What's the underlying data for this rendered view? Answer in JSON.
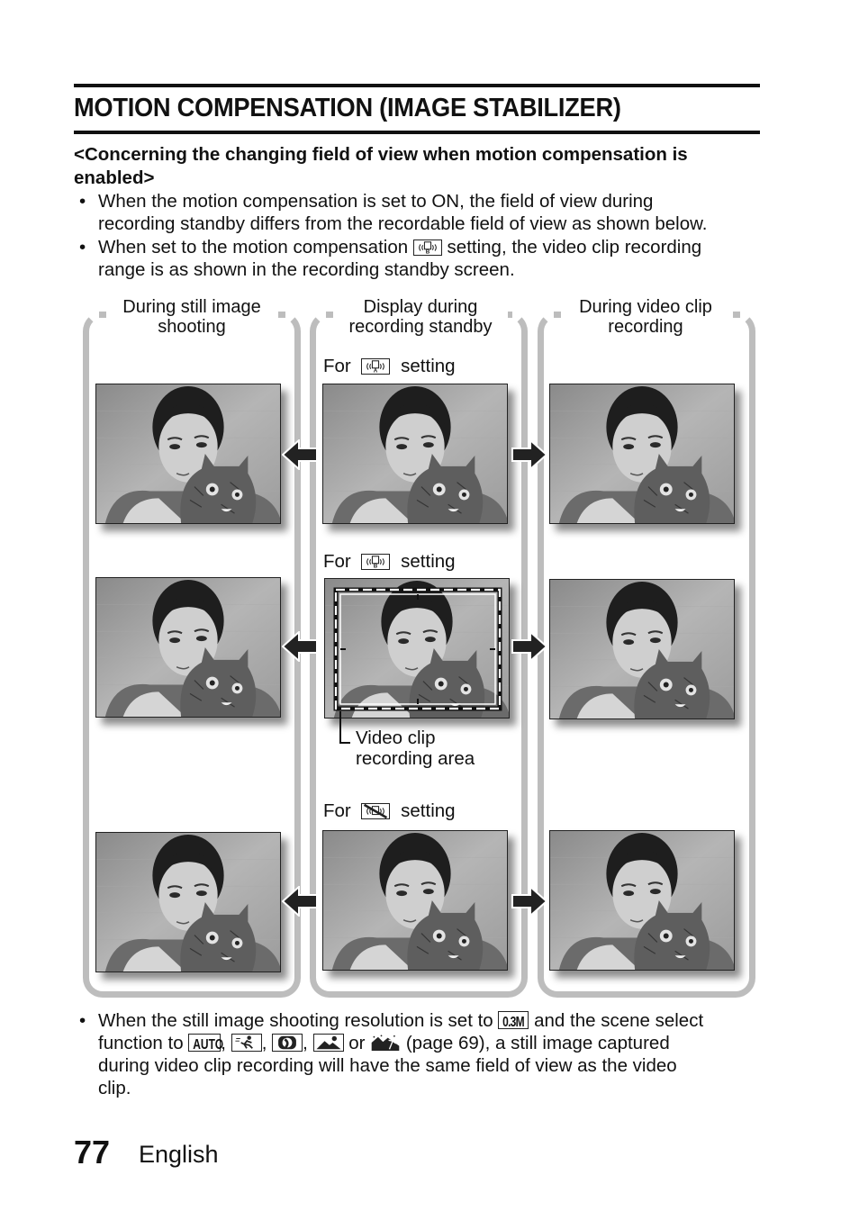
{
  "page": {
    "title": "MOTION COMPENSATION (IMAGE STABILIZER)",
    "subheading": "<Concerning the changing field of view when motion compensation is enabled>",
    "subheading_lines": [
      "<Concerning the changing field of view when motion compensation is",
      "enabled>"
    ],
    "bullets": [
      {
        "lines": [
          "When the motion compensation is set to ON, the field of view during",
          "recording standby differs from the recordable field of view as shown below."
        ]
      },
      {
        "line1_before_icon": "When set to the motion compensation",
        "line1_icon": "stabilizer-b-icon",
        "line1_after_icon": "setting, the video clip recording",
        "line2": "range is as shown in the recording standby screen."
      }
    ],
    "bullet_glyph": "•"
  },
  "diagram": {
    "columns": [
      {
        "label_lines": [
          "During still image",
          "shooting"
        ]
      },
      {
        "label_lines": [
          "Display during",
          "recording standby"
        ]
      },
      {
        "label_lines": [
          "During video clip",
          "recording"
        ]
      }
    ],
    "rows": [
      {
        "prefix": "For",
        "icon": "stabilizer-a-icon",
        "suffix": "setting"
      },
      {
        "prefix": "For",
        "icon": "stabilizer-b-icon",
        "suffix": "setting"
      },
      {
        "prefix": "For",
        "icon": "stabilizer-off-icon",
        "suffix": "setting"
      }
    ],
    "callout_lines": [
      "Video clip",
      "recording area"
    ],
    "photo_description": "Woman holding a tabby cat against a white brick wall (grayscale)",
    "colors": {
      "bracket": "#bdbdbd",
      "arrow": "#222222",
      "text": "#111111"
    }
  },
  "bottom_note": {
    "line1_before": "When the still image shooting resolution is set to",
    "line1_icon": "resolution-0.3m-icon",
    "line1_icon_text": "0.3M",
    "line1_after": "and the scene select",
    "line2_before": "function to",
    "line2_icons": [
      "auto-icon",
      "sports-icon",
      "portrait-icon",
      "landscape-icon",
      "night-scenery-icon"
    ],
    "auto_icon_text": "AUTO",
    "sep_comma": ",",
    "sep_or": "or",
    "line2_after": "(page 69), a still image captured",
    "line3": "during video clip recording will have the same field of view as the video",
    "line4": "clip."
  },
  "footer": {
    "page_number": "77",
    "language": "English"
  }
}
